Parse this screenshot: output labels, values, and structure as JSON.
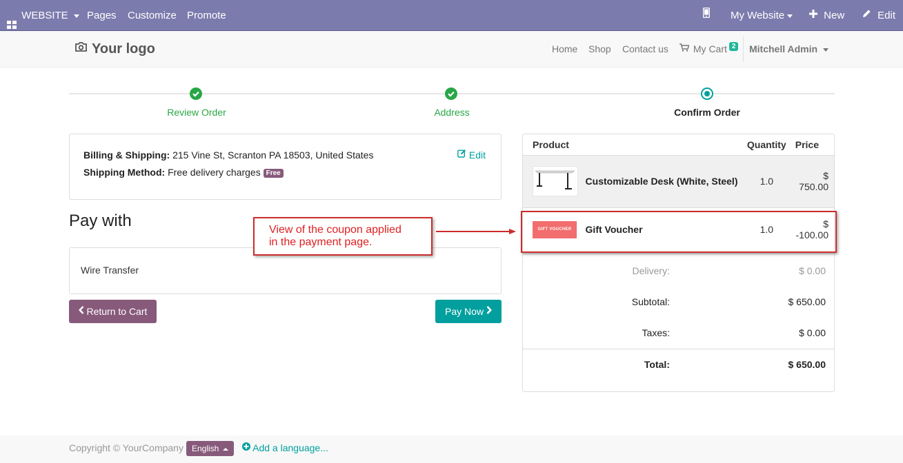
{
  "topbar": {
    "website_label": "WEBSITE",
    "pages_label": "Pages",
    "customize_label": "Customize",
    "promote_label": "Promote",
    "my_website_label": "My Website",
    "new_label": "New",
    "edit_label": "Edit"
  },
  "navbar": {
    "logo_text": "Your logo",
    "links": [
      "Home",
      "Shop",
      "Contact us"
    ],
    "cart_label": "My Cart",
    "cart_count": "2",
    "user_name": "Mitchell Admin"
  },
  "progress": {
    "steps": [
      {
        "label": "Review Order",
        "state": "done"
      },
      {
        "label": "Address",
        "state": "done"
      },
      {
        "label": "Confirm Order",
        "state": "current"
      }
    ]
  },
  "billing": {
    "billing_label": "Billing & Shipping:",
    "billing_value": "215 Vine St, Scranton PA 18503, United States",
    "method_label": "Shipping Method:",
    "method_value": "Free delivery charges",
    "method_badge": "Free",
    "edit_label": "Edit"
  },
  "payment": {
    "heading": "Pay with",
    "option": "Wire Transfer",
    "return_label": "Return to Cart",
    "pay_label": "Pay Now"
  },
  "callout": {
    "line1": "View of the coupon applied",
    "line2": "in the payment page."
  },
  "cart": {
    "headers": {
      "product": "Product",
      "quantity": "Quantity",
      "price": "Price"
    },
    "rows": [
      {
        "name": "Customizable Desk (White, Steel)",
        "qty": "1.0",
        "price": "$ 750.00",
        "thumb": "desk-image"
      },
      {
        "name": "Gift Voucher",
        "qty": "1.0",
        "price": "$ -100.00",
        "thumb": "gift-voucher-image",
        "thumb_text": "GIFT VOUCHER"
      }
    ],
    "summary": {
      "delivery_label": "Delivery:",
      "delivery_value": "$ 0.00",
      "subtotal_label": "Subtotal:",
      "subtotal_value": "$ 650.00",
      "taxes_label": "Taxes:",
      "taxes_value": "$ 0.00",
      "total_label": "Total:",
      "total_value": "$ 650.00"
    }
  },
  "footer": {
    "copyright": "Copyright © YourCompany",
    "language": "English",
    "add_language": "Add a language..."
  },
  "colors": {
    "topbar": "#7c7bad",
    "accent_green": "#28a745",
    "teal": "#01a09e",
    "primary_purple": "#875a7b",
    "annotation_red": "#cc2b2b"
  }
}
